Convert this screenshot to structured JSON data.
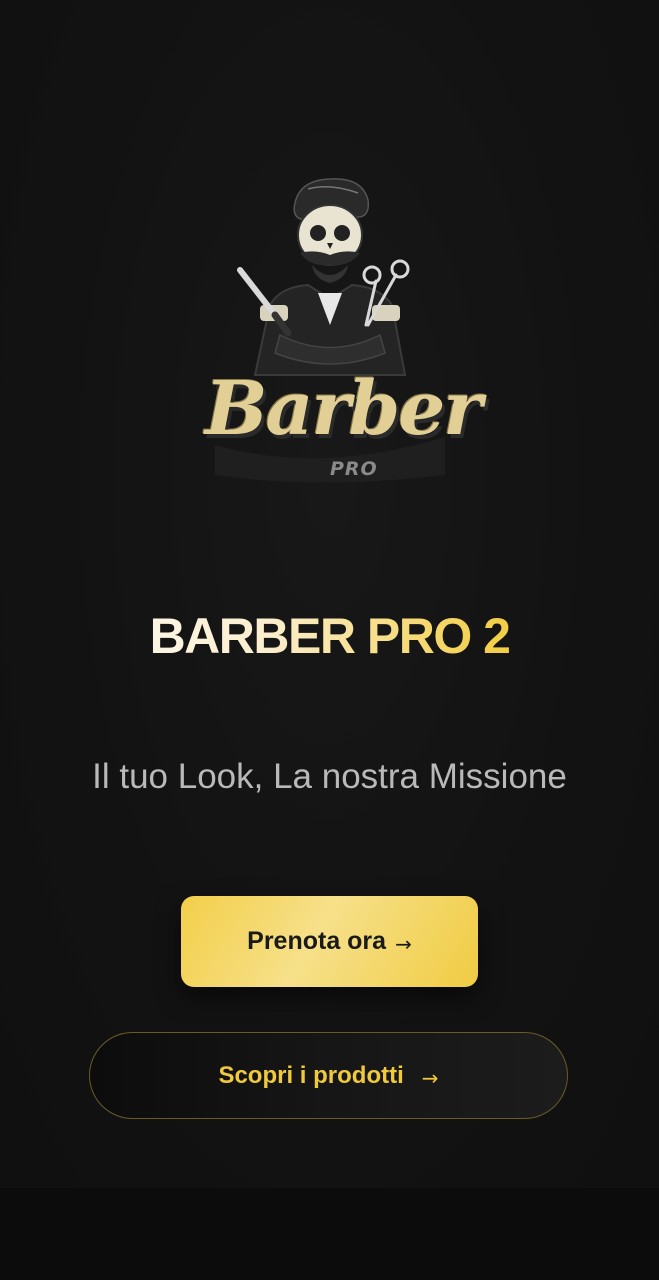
{
  "logo": {
    "text": "Barber",
    "subtext": "PRO",
    "icon": "skeleton-barber-logo"
  },
  "title": "BARBER PRO 2",
  "tagline": "Il tuo Look, La nostra Missione",
  "primary_button": {
    "label": "Prenota ora",
    "arrow": "→"
  },
  "secondary_button": {
    "label": "Scopri i prodotti",
    "arrow": "→"
  },
  "colors": {
    "background": "#121212",
    "accent_gold": "#f0c93d",
    "primary_button_bg": "#f3cf49",
    "tagline": "#b9b9b9"
  }
}
